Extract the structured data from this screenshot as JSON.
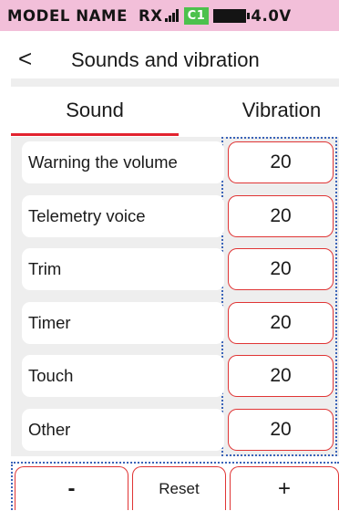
{
  "status_bar": {
    "model_name": "MODEL NAME",
    "receiver": "RX",
    "channel_badge": "C1",
    "channel_badge_color": "#4cc14c",
    "battery_voltage": "4.0V",
    "background_color": "#f2bfd9",
    "icons": [
      "signal-strength-icon",
      "battery-icon"
    ]
  },
  "header": {
    "back_icon": "<",
    "title": "Sounds and vibration"
  },
  "tabs": [
    {
      "label": "Sound",
      "active": true
    },
    {
      "label": "Vibration",
      "active": false
    }
  ],
  "accent_color": "#e2232f",
  "settings": [
    {
      "label": "Warning the volume",
      "value": "20"
    },
    {
      "label": "Telemetry voice",
      "value": "20"
    },
    {
      "label": "Trim",
      "value": "20"
    },
    {
      "label": "Timer",
      "value": "20"
    },
    {
      "label": "Touch",
      "value": "20"
    },
    {
      "label": "Other",
      "value": "20"
    }
  ],
  "buttons": {
    "minus": "-",
    "reset": "Reset",
    "plus": "+"
  }
}
